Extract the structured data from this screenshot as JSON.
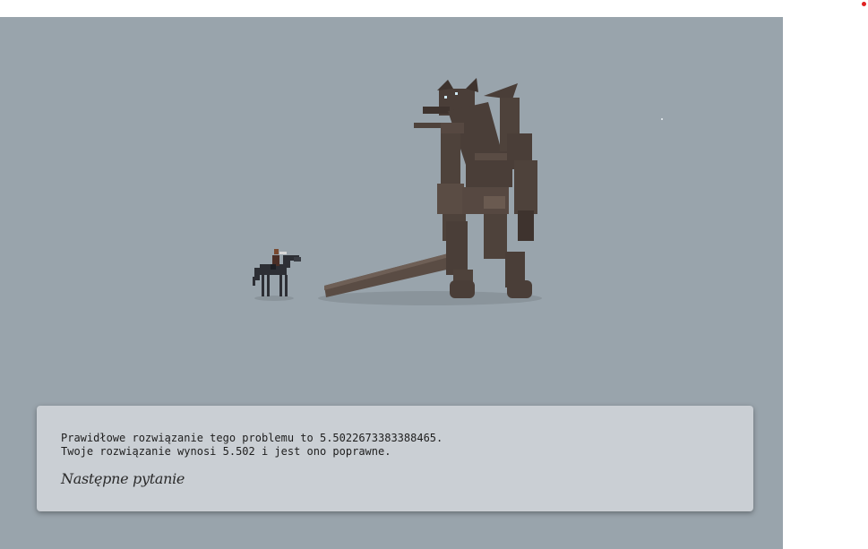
{
  "dialog": {
    "line1": "Prawidłowe rozwiązanie tego problemu to 5.5022673383388465.",
    "line2": "Twoje rozwiązanie wynosi 5.502 i jest ono poprawne.",
    "next_label": "Następne pytanie"
  },
  "colors": {
    "background": "#99a4ac",
    "colossus": "#4a3e38",
    "dialog_bg": "#cacfd4",
    "indicator": "#e02020"
  },
  "icons": [
    "horse-rider-sprite",
    "colossus-sprite"
  ]
}
